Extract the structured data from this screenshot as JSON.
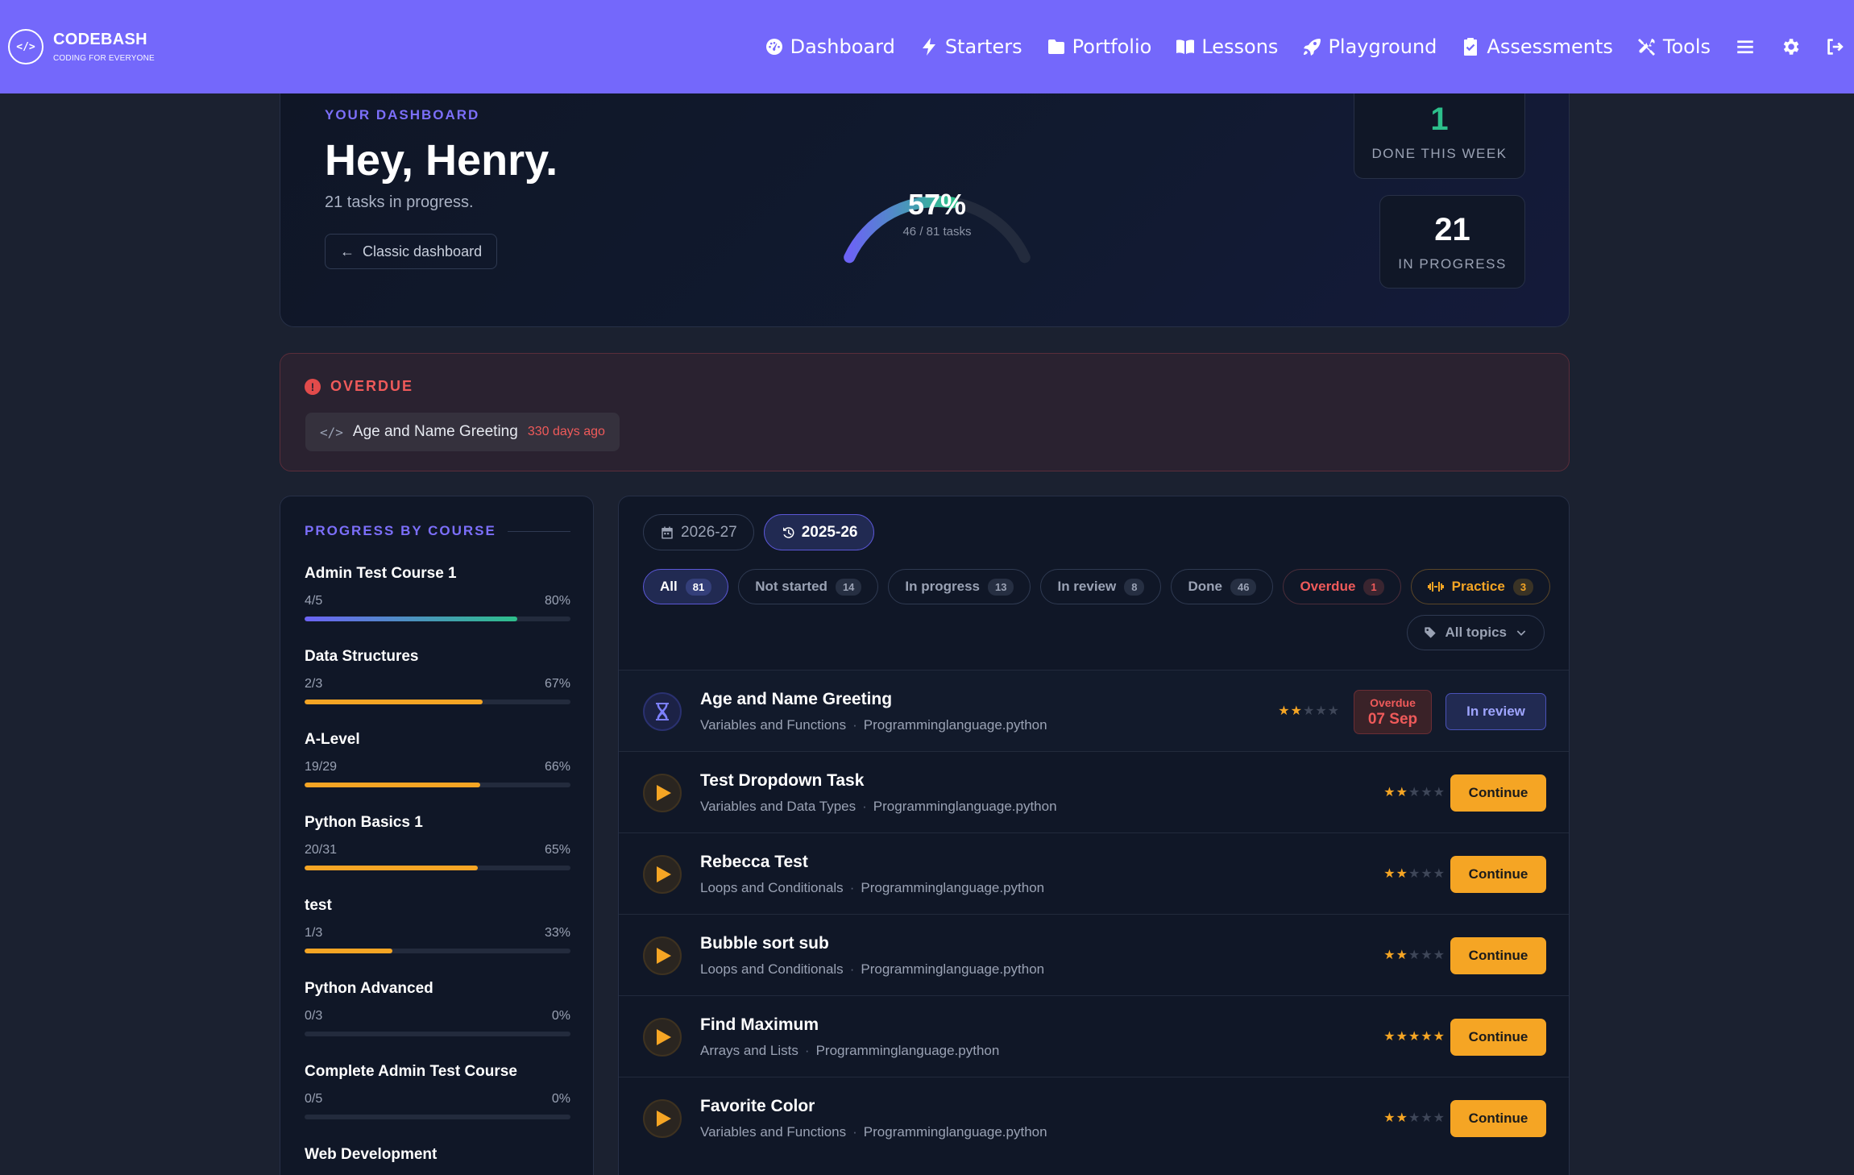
{
  "brand": {
    "name": "CODEBASH",
    "tagline": "CODING FOR EVERYONE",
    "logo": "</>"
  },
  "nav": {
    "items": [
      {
        "label": "Dashboard",
        "icon": "gauge-icon"
      },
      {
        "label": "Starters",
        "icon": "bolt-icon"
      },
      {
        "label": "Portfolio",
        "icon": "folder-icon"
      },
      {
        "label": "Lessons",
        "icon": "book-icon"
      },
      {
        "label": "Playground",
        "icon": "rocket-icon"
      },
      {
        "label": "Assessments",
        "icon": "clipboard-check-icon"
      },
      {
        "label": "Tools",
        "icon": "tools-icon"
      }
    ],
    "icons": [
      "menu-icon",
      "gear-icon",
      "logout-icon"
    ]
  },
  "hero": {
    "kicker": "YOUR DASHBOARD",
    "title": "Hey, Henry.",
    "subtitle": "21 tasks in progress.",
    "classic_button": "Classic dashboard",
    "gauge": {
      "percent_label": "57%",
      "tasks_label": "46 / 81 tasks",
      "fraction": 0.57
    },
    "stats": {
      "done_week": {
        "value": "1",
        "label": "DONE THIS WEEK"
      },
      "in_progress": {
        "value": "21",
        "label": "IN PROGRESS"
      }
    }
  },
  "overdue": {
    "heading": "OVERDUE",
    "alert_glyph": "!",
    "code_glyph": "</>",
    "item": {
      "name": "Age and Name Greeting",
      "ago": "330 days ago"
    }
  },
  "courses": {
    "heading": "PROGRESS BY COURSE",
    "items": [
      {
        "name": "Admin Test Course 1",
        "count": "4/5",
        "pct": "80%",
        "fraction": 0.8
      },
      {
        "name": "Data Structures",
        "count": "2/3",
        "pct": "67%",
        "fraction": 0.67
      },
      {
        "name": "A-Level",
        "count": "19/29",
        "pct": "66%",
        "fraction": 0.66
      },
      {
        "name": "Python Basics 1",
        "count": "20/31",
        "pct": "65%",
        "fraction": 0.65
      },
      {
        "name": "test",
        "count": "1/3",
        "pct": "33%",
        "fraction": 0.33
      },
      {
        "name": "Python Advanced",
        "count": "0/3",
        "pct": "0%",
        "fraction": 0
      },
      {
        "name": "Complete Admin Test Course",
        "count": "0/5",
        "pct": "0%",
        "fraction": 0
      },
      {
        "name": "Web Development",
        "count": "",
        "pct": "",
        "fraction": 0
      }
    ]
  },
  "tasks": {
    "years": [
      {
        "label": "2026-27",
        "icon": "calendar-icon"
      },
      {
        "label": "2025-26",
        "icon": "history-icon"
      }
    ],
    "filters": [
      {
        "label": "All",
        "count": "81"
      },
      {
        "label": "Not started",
        "count": "14"
      },
      {
        "label": "In progress",
        "count": "13"
      },
      {
        "label": "In review",
        "count": "8"
      },
      {
        "label": "Done",
        "count": "46"
      },
      {
        "label": "Overdue",
        "count": "1"
      }
    ],
    "practice": {
      "label": "Practice",
      "count": "3",
      "icon": "dumbbell-icon"
    },
    "topics_label": "All topics",
    "rows": [
      {
        "title": "Age and Name Greeting",
        "topic": "Variables and Functions",
        "lang": "Programminglanguage.python",
        "stars": 2,
        "status": "In review",
        "due_label": "Overdue",
        "due_date": "07 Sep",
        "sep": "·"
      },
      {
        "title": "Test Dropdown Task",
        "topic": "Variables and Data Types",
        "lang": "Programminglanguage.python",
        "stars": 2,
        "status": "Continue",
        "sep": "·"
      },
      {
        "title": "Rebecca Test",
        "topic": "Loops and Conditionals",
        "lang": "Programminglanguage.python",
        "stars": 2,
        "status": "Continue",
        "sep": "·"
      },
      {
        "title": "Bubble sort sub",
        "topic": "Loops and Conditionals",
        "lang": "Programminglanguage.python",
        "stars": 2,
        "status": "Continue",
        "sep": "·"
      },
      {
        "title": "Find Maximum",
        "topic": "Arrays and Lists",
        "lang": "Programminglanguage.python",
        "stars": 5,
        "status": "Continue",
        "sep": "·"
      },
      {
        "title": "Favorite Color",
        "topic": "Variables and Functions",
        "lang": "Programminglanguage.python",
        "stars": 2,
        "status": "Continue",
        "sep": "·"
      }
    ]
  },
  "colors": {
    "brand": "#7468fb",
    "accent": "#f5a524",
    "danger": "#ef5a5a",
    "success": "#2dbf8b"
  }
}
